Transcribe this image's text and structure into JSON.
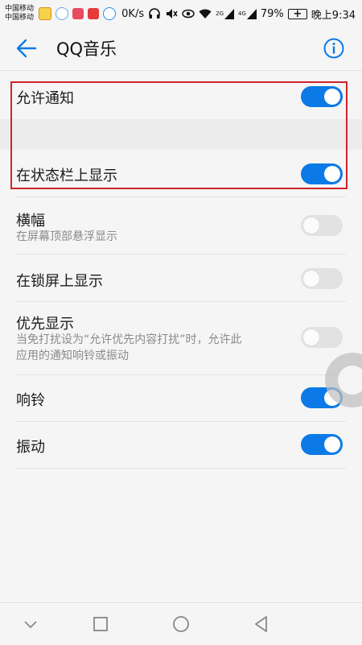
{
  "status_bar": {
    "carrier1": "中国移动",
    "carrier2": "中国移动",
    "net_speed": "0K/s",
    "signal1_label": "2G",
    "signal2_label": "4G",
    "battery_percent": "79%",
    "time": "晚上9:34"
  },
  "header": {
    "title": "QQ音乐",
    "accent_color": "#0b7ae6"
  },
  "settings": [
    {
      "label": "允许通知",
      "subtitle": "",
      "enabled": true
    },
    {
      "label": "在状态栏上显示",
      "subtitle": "",
      "enabled": true
    },
    {
      "label": "横幅",
      "subtitle": "在屏幕顶部悬浮显示",
      "enabled": false
    },
    {
      "label": "在锁屏上显示",
      "subtitle": "",
      "enabled": false
    },
    {
      "label": "优先显示",
      "subtitle_line1": "当免打扰设为“允许优先内容打扰”时，允许此",
      "subtitle_line2": "应用的通知响铃或振动",
      "enabled": false
    },
    {
      "label": "响铃",
      "subtitle": "",
      "enabled": true
    },
    {
      "label": "振动",
      "subtitle": "",
      "enabled": true
    }
  ],
  "nav_icons": [
    "chevron-down-icon",
    "square-icon",
    "circle-icon",
    "triangle-back-icon"
  ]
}
